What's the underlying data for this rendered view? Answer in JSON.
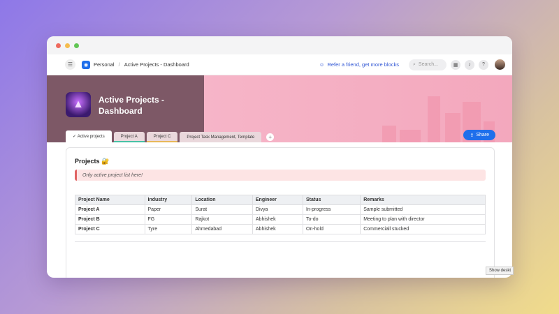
{
  "breadcrumb": {
    "workspace": "Personal",
    "page": "Active Projects - Dashboard"
  },
  "topbar": {
    "refer": "Refer a friend, get more blocks",
    "search_placeholder": "Search..."
  },
  "dashboard": {
    "title": "Active Projects - Dashboard"
  },
  "tabs": [
    {
      "label": "Active projects"
    },
    {
      "label": "Project A"
    },
    {
      "label": "Project C"
    },
    {
      "label": "Project Task Management, Template"
    }
  ],
  "share": {
    "label": "Share"
  },
  "section": {
    "title": "Projects 🔐",
    "callout": "Only active project list here!"
  },
  "table": {
    "headers": [
      "Project Name",
      "Industry",
      "Location",
      "Engineer",
      "Status",
      "Remarks"
    ],
    "rows": [
      [
        "Project A",
        "Paper",
        "Surat",
        "Divya",
        "In-progress",
        "Sample submitted"
      ],
      [
        "Project B",
        "FG",
        "Rajkot",
        "Abhishek",
        "To-do",
        "Meeting to plan with director"
      ],
      [
        "Project C",
        "Tyre",
        "Ahmedabad",
        "Abhishek",
        "On-hold",
        "Commerciall stucked"
      ]
    ]
  },
  "tooltip": {
    "text": "Show deskt"
  },
  "colors": {
    "accent": "#1f6feb",
    "banner_left": "#7d5866",
    "banner_right": "#f6b5c8",
    "callout_bg": "#fde4e4"
  }
}
